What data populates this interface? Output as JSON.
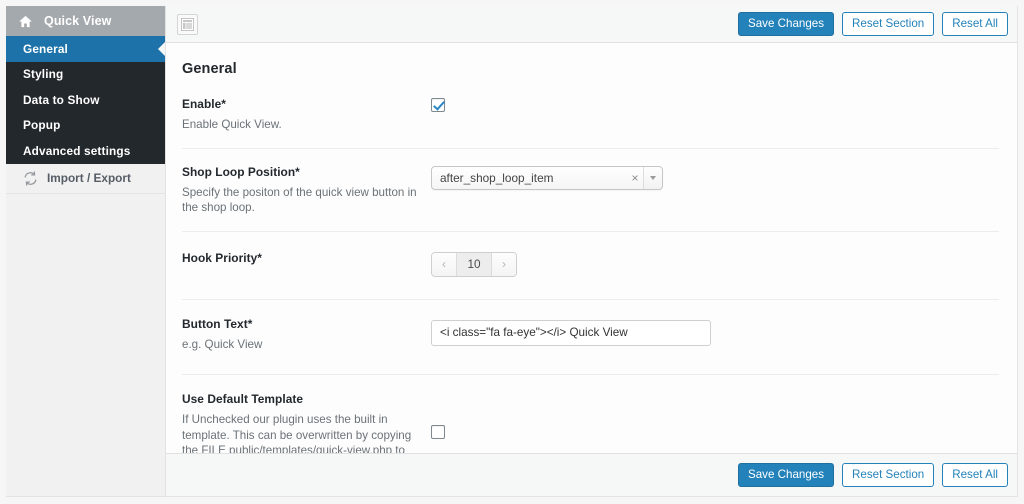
{
  "sidebar": {
    "header": {
      "title": "Quick View",
      "icon": "home-icon"
    },
    "items": [
      {
        "label": "General",
        "active": true
      },
      {
        "label": "Styling",
        "active": false
      },
      {
        "label": "Data to Show",
        "active": false
      },
      {
        "label": "Popup",
        "active": false
      },
      {
        "label": "Advanced settings",
        "active": false
      }
    ],
    "sub_item": {
      "label": "Import / Export",
      "icon": "sync-icon"
    }
  },
  "toolbar": {
    "expand_icon": "layout-toggle-icon",
    "save_label": "Save Changes",
    "reset_section_label": "Reset Section",
    "reset_all_label": "Reset All"
  },
  "main": {
    "section_title": "General",
    "fields": [
      {
        "title": "Enable*",
        "desc": "Enable Quick View.",
        "control": "checkbox",
        "checked": true
      },
      {
        "title": "Shop Loop Position*",
        "desc": "Specify the positon of the quick view button in the shop loop.",
        "control": "select",
        "value": "after_shop_loop_item",
        "clear_glyph": "×"
      },
      {
        "title": "Hook Priority*",
        "desc": "",
        "control": "spinner",
        "value": "10",
        "prev_glyph": "‹",
        "next_glyph": "›"
      },
      {
        "title": "Button Text*",
        "desc": "e.g. Quick View",
        "control": "text",
        "value": "<i class=\"fa fa-eye\"></i> Quick View",
        "placeholder": ""
      },
      {
        "title": "Use Default Template",
        "desc": "If Unchecked our plugin uses the built in template. This can be overwritten by copying the FILE public/templates/quick-view.php to your themes folder",
        "control": "checkbox",
        "checked": false
      }
    ]
  },
  "colors": {
    "accent": "#2482ba",
    "sidebar_dark": "#23282d",
    "sidebar_header": "#a4a9ad",
    "active_item": "#1d72aa"
  }
}
